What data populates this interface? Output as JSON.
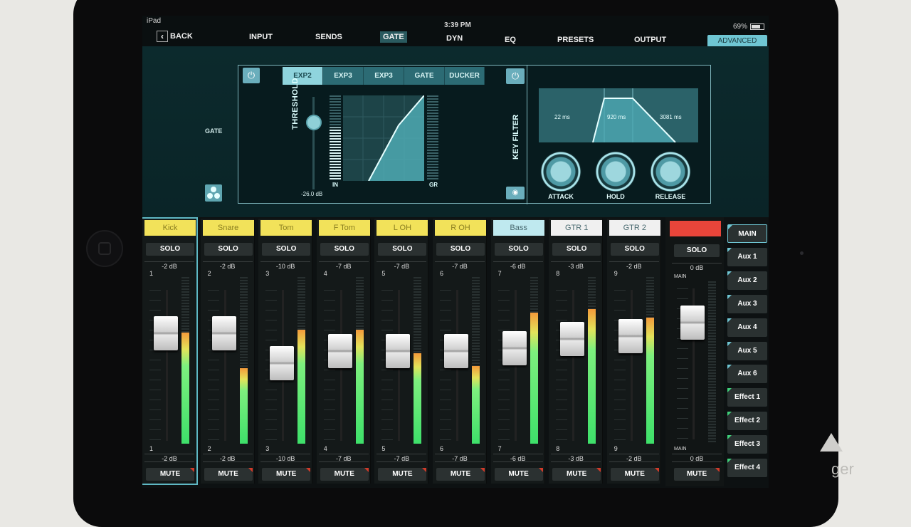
{
  "status": {
    "carrier": "iPad",
    "time": "3:39 PM",
    "battery": "69%"
  },
  "nav": {
    "back": "BACK",
    "tabs": [
      "INPUT",
      "SENDS",
      "GATE",
      "DYN",
      "EQ",
      "PRESETS",
      "OUTPUT"
    ],
    "active_tab": "GATE",
    "advanced": "ADVANCED"
  },
  "gate": {
    "side_label": "GATE",
    "modes": [
      "EXP2",
      "EXP3",
      "EXP3",
      "GATE",
      "DUCKER"
    ],
    "active_mode": "EXP2",
    "threshold_label": "THRESHOLD",
    "threshold_value": "-26.0 dB",
    "in_label": "IN",
    "gr_label": "GR",
    "key_filter_label": "KEY FILTER",
    "envelope": {
      "attack": "22 ms",
      "hold": "920 ms",
      "release": "3081 ms"
    },
    "knobs": [
      "ATTACK",
      "HOLD",
      "RELEASE"
    ]
  },
  "channels": [
    {
      "num": "1",
      "name": "Kick",
      "db": "-2 dB",
      "color": "#f2e25a",
      "fader": 0.78,
      "meter": 0.66,
      "selected": true
    },
    {
      "num": "2",
      "name": "Snare",
      "db": "-2 dB",
      "color": "#f2e25a",
      "fader": 0.78,
      "meter": 0.45
    },
    {
      "num": "3",
      "name": "Tom",
      "db": "-10 dB",
      "color": "#f2e25a",
      "fader": 0.58,
      "meter": 0.68
    },
    {
      "num": "4",
      "name": "F Tom",
      "db": "-7 dB",
      "color": "#f2e25a",
      "fader": 0.66,
      "meter": 0.68
    },
    {
      "num": "5",
      "name": "L OH",
      "db": "-7 dB",
      "color": "#f2e25a",
      "fader": 0.66,
      "meter": 0.54
    },
    {
      "num": "6",
      "name": "R OH",
      "db": "-7 dB",
      "color": "#f2e25a",
      "fader": 0.66,
      "meter": 0.46
    },
    {
      "num": "7",
      "name": "Bass",
      "db": "-6 dB",
      "color": "#bfe9ef",
      "fader": 0.68,
      "meter": 0.78
    },
    {
      "num": "8",
      "name": "GTR 1",
      "db": "-3 dB",
      "color": "#f0f0f0",
      "fader": 0.74,
      "meter": 0.8
    },
    {
      "num": "9",
      "name": "GTR 2",
      "db": "-2 dB",
      "color": "#f0f0f0",
      "fader": 0.76,
      "meter": 0.75
    }
  ],
  "solo_label": "SOLO",
  "mute_label": "MUTE",
  "main": {
    "db_top": "0 dB",
    "db_bot": "0 dB",
    "sub_top": "MAIN",
    "sub_bot": "MAIN",
    "color": "#e8453a",
    "fader": 0.8
  },
  "buses": [
    "MAIN",
    "Aux 1",
    "Aux 2",
    "Aux 3",
    "Aux 4",
    "Aux 5",
    "Aux 6",
    "Effect 1",
    "Effect 2",
    "Effect 3",
    "Effect 4"
  ],
  "watermark": "ger"
}
